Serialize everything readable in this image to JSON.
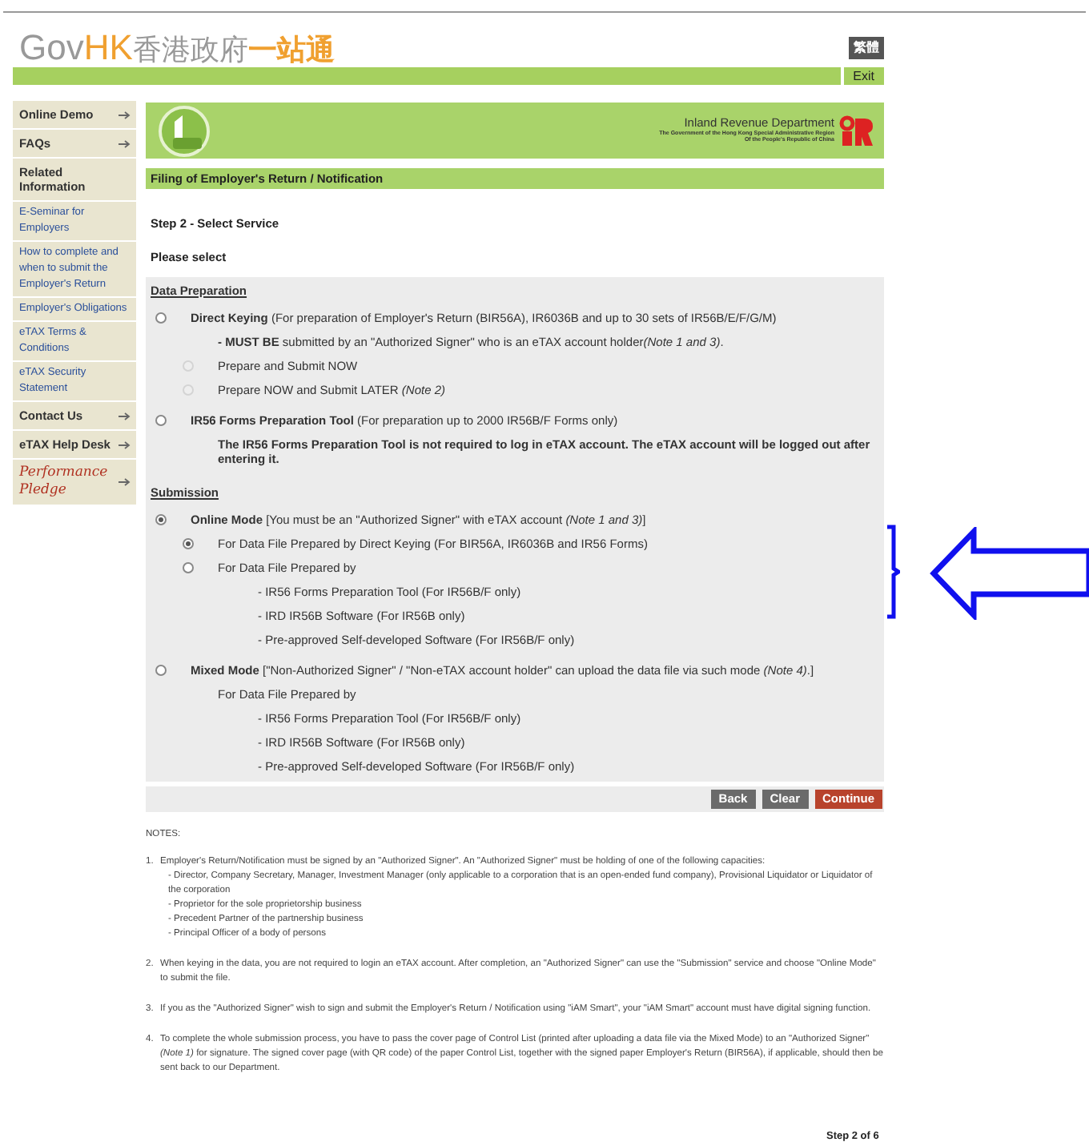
{
  "header": {
    "logo_gov": "Gov",
    "logo_hk": "HK",
    "logo_cn_1": "香港政府",
    "logo_cn_2": "一站通",
    "language_button": "繁體",
    "exit_button": "Exit"
  },
  "sidebar": {
    "items": [
      {
        "kind": "menu",
        "label": "Online Demo",
        "arrow": true
      },
      {
        "kind": "menu",
        "label": "FAQs",
        "arrow": true
      },
      {
        "kind": "menu",
        "label": "Related Information",
        "arrow": false
      },
      {
        "kind": "link",
        "label": "E-Seminar for Employers",
        "arrow": false
      },
      {
        "kind": "link",
        "label": "How to complete and when to submit the Employer's Return",
        "arrow": false
      },
      {
        "kind": "link",
        "label": "Employer's Obligations",
        "arrow": false
      },
      {
        "kind": "link",
        "label": "eTAX Terms & Conditions",
        "arrow": false
      },
      {
        "kind": "link",
        "label": "eTAX Security Statement",
        "arrow": false
      },
      {
        "kind": "menu",
        "label": "Contact Us",
        "arrow": true
      },
      {
        "kind": "menu",
        "label": "eTAX Help Desk",
        "arrow": true
      },
      {
        "kind": "pledge",
        "label": "Performance Pledge",
        "arrow": true
      }
    ]
  },
  "banner": {
    "department": "Inland Revenue Department",
    "subtitle_1": "The Government of the Hong Kong Special Administrative Region",
    "subtitle_2": "Of the People's Republic of China"
  },
  "page_title": "Filing of Employer's Return / Notification",
  "step_title": "Step 2 - Select Service",
  "prompt": "Please select",
  "sections": [
    {
      "heading": "Data Preparation",
      "options": [
        {
          "kind": "radio",
          "selected": false,
          "disabled": false,
          "text": "**Direct Keying** (For preparation of Employer's Return (BIR56A), IR6036B and up to 30 sets of IR56B/E/F/G/M)",
          "children": [
            {
              "kind": "text",
              "text": "**- MUST BE** submitted by an \"Authorized Signer\" who is an eTAX account holder",
              "italic_note": "(Note 1 and 3)",
              "after_note": "."
            },
            {
              "kind": "radio",
              "selected": false,
              "disabled": true,
              "text": "Prepare and Submit NOW"
            },
            {
              "kind": "radio",
              "selected": false,
              "disabled": true,
              "text": "Prepare NOW and Submit LATER *(Note 2)*"
            }
          ]
        },
        {
          "kind": "radio",
          "selected": false,
          "disabled": false,
          "text": "**IR56 Forms Preparation Tool** (For preparation up to 2000 IR56B/F Forms only)",
          "children": [
            {
              "kind": "text",
              "text": "**The IR56 Forms Preparation Tool is not required to log in eTAX account. The eTAX account will be logged out after entering it.**"
            }
          ]
        }
      ]
    },
    {
      "heading": "Submission",
      "options": [
        {
          "kind": "radio",
          "selected": true,
          "disabled": false,
          "text": "**Online Mode** [You must be an \"Authorized Signer\" with eTAX account *(Note 1 and 3)*]",
          "children": [
            {
              "kind": "radio",
              "selected": true,
              "disabled": false,
              "text": "For Data File Prepared by Direct Keying (For BIR56A, IR6036B and IR56 Forms)"
            },
            {
              "kind": "radio",
              "selected": false,
              "disabled": false,
              "text": "For Data File Prepared by",
              "children": [
                {
                  "kind": "text",
                  "text": "- IR56 Forms Preparation Tool (For IR56B/F only)"
                },
                {
                  "kind": "text",
                  "text": "- IRD IR56B Software (For IR56B only)"
                },
                {
                  "kind": "text",
                  "text": "- Pre-approved Self-developed Software (For IR56B/F only)"
                }
              ]
            }
          ]
        },
        {
          "kind": "radio",
          "selected": false,
          "disabled": false,
          "text": "**Mixed Mode** [\"Non-Authorized Signer\" / \"Non-eTAX account holder\" can upload the data file via such mode *(Note 4)*.]",
          "children": [
            {
              "kind": "text",
              "text": "For Data File Prepared by",
              "children": [
                {
                  "kind": "text",
                  "text": "- IR56 Forms Preparation Tool (For IR56B/F only)"
                },
                {
                  "kind": "text",
                  "text": "- IRD IR56B Software (For IR56B only)"
                },
                {
                  "kind": "text",
                  "text": "- Pre-approved Self-developed Software (For IR56B/F only)"
                }
              ]
            }
          ]
        }
      ]
    }
  ],
  "buttons": [
    {
      "kind": "secondary",
      "label": "Back"
    },
    {
      "kind": "secondary",
      "label": "Clear"
    },
    {
      "kind": "primary",
      "label": "Continue"
    }
  ],
  "notes": {
    "heading": "NOTES:",
    "items": [
      {
        "number": "1.",
        "text": "Employer's Return/Notification must be signed by an \"Authorized Signer\". An \"Authorized Signer\" must be holding of one of the following capacities:",
        "sub_items": [
          "- Director, Company Secretary, Manager, Investment Manager (only applicable to a corporation that is an open-ended fund company), Provisional Liquidator or Liquidator of the corporation",
          "- Proprietor for the sole proprietorship business",
          "- Precedent Partner of the partnership business",
          "- Principal Officer of a body of persons"
        ]
      },
      {
        "number": "2.",
        "text": "When keying in the data, you are not required to login an eTAX account. After completion, an \"Authorized Signer\" can use the \"Submission\" service and choose \"Online Mode\" to submit the file."
      },
      {
        "number": "3.",
        "text": "If you as the \"Authorized Signer\" wish to sign and submit the Employer's Return / Notification using \"iAM Smart\", your \"iAM Smart\" account must have digital signing function."
      },
      {
        "number": "4.",
        "text": "To complete the whole submission process, you have to pass the cover page of Control List (printed after uploading a data file via the Mixed Mode) to an \"Authorized Signer\" *(Note 1)* for signature. The signed cover page (with QR code) of the paper Control List, together with the signed paper Employer's Return (BIR56A), if applicable, should then be sent back to our Department."
      }
    ]
  },
  "step_indicator": "Step 2 of 6"
}
